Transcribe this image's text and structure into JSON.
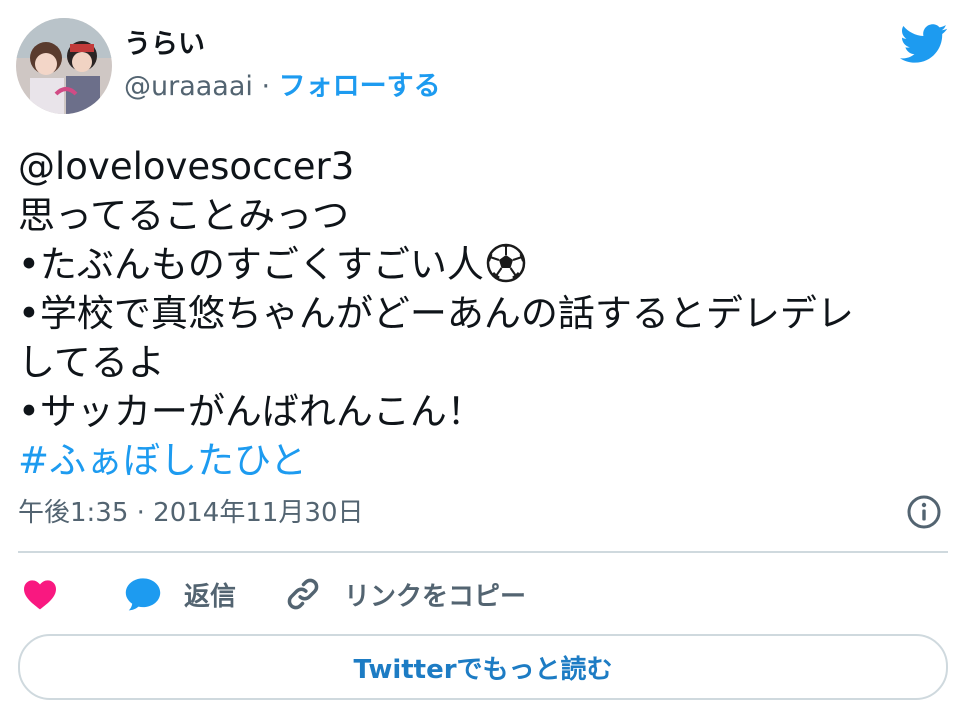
{
  "user": {
    "display_name": "うらい",
    "handle": "@uraaaai",
    "separator": " · ",
    "follow_label": "フォローする"
  },
  "tweet": {
    "lines": [
      "@lovelovesoccer3",
      "思ってることみっつ",
      "•たぶんものすごくすごい人",
      "•学校で真悠ちゃんがどーあんの話するとデレデレ",
      "してるよ",
      "•サッカーがんばれんこん！"
    ],
    "hashtag": "#ふぁぼしたひと",
    "emoji": "soccer-ball-icon"
  },
  "meta": {
    "timestamp": "午後1:35 · 2014年11月30日"
  },
  "actions": {
    "reply_label": "返信",
    "copy_link_label": "リンクをコピー",
    "read_more_label": "Twitterでもっと読む"
  },
  "icons": {
    "twitter": "twitter-bird-icon",
    "info": "info-icon",
    "like": "heart-icon",
    "reply": "speech-bubble-icon",
    "link": "link-icon"
  },
  "colors": {
    "accent": "#1d9bf0",
    "like": "#f91880",
    "secondary_text": "#536471",
    "border": "#cfd9de"
  }
}
